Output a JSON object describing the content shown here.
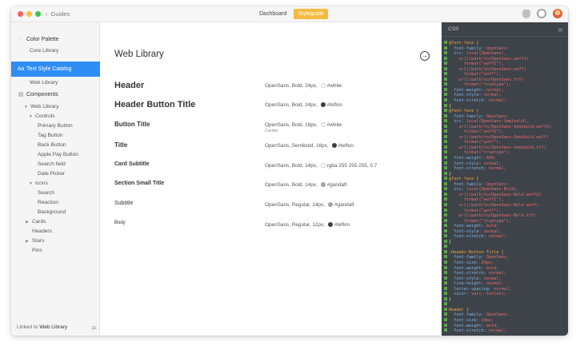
{
  "titlebar": {
    "back_label": "Guides",
    "tabs": [
      {
        "label": "Dashboard",
        "active": false
      },
      {
        "label": "Styleguide",
        "active": true
      }
    ],
    "accent": "#f7b93e"
  },
  "sidebar": {
    "items": [
      {
        "label": "Color Palette",
        "kind": "section"
      },
      {
        "label": "Core Library",
        "kind": "sub"
      },
      {
        "label": "Text Style Catalog",
        "kind": "section-selected"
      },
      {
        "label": "Web Library",
        "kind": "sub"
      },
      {
        "label": "Components",
        "kind": "section"
      },
      {
        "label": "Web Library",
        "kind": "tree1"
      },
      {
        "label": "Controls",
        "kind": "tree2"
      },
      {
        "label": "Primary Button",
        "kind": "leaf"
      },
      {
        "label": "Tag Button",
        "kind": "leaf"
      },
      {
        "label": "Back Button",
        "kind": "leaf"
      },
      {
        "label": "Apple Pay Button",
        "kind": "leaf"
      },
      {
        "label": "Search field",
        "kind": "leaf"
      },
      {
        "label": "Date Picker",
        "kind": "leaf"
      },
      {
        "label": "Icons",
        "kind": "tree2"
      },
      {
        "label": "Search",
        "kind": "leaf"
      },
      {
        "label": "Reaction",
        "kind": "leaf"
      },
      {
        "label": "Background",
        "kind": "leaf"
      },
      {
        "label": "Cards",
        "kind": "tree2c"
      },
      {
        "label": "Headers",
        "kind": "tree2n"
      },
      {
        "label": "Stars",
        "kind": "tree2c"
      },
      {
        "label": "Pins",
        "kind": "tree2n"
      }
    ],
    "footer_prefix": "Linked to",
    "footer_link": "Web Library",
    "selected_color": "#2e8ef6"
  },
  "main": {
    "title": "Web Library",
    "styles": [
      {
        "name": "Header",
        "desc": "OpenSans, Bold, 24px,",
        "color_name": "#white",
        "swatch": "#ffffff",
        "sub": ""
      },
      {
        "name": "Header Button Title",
        "desc": "OpenSans, Bold, 24px,",
        "color_name": "#teflon",
        "swatch": "#3b3f46",
        "sub": ""
      },
      {
        "name": "Button Title",
        "desc": "OpenSans, Bold, 16px,",
        "color_name": "#white",
        "swatch": "#ffffff",
        "sub": "Center"
      },
      {
        "name": "Title",
        "desc": "OpenSans, Semibold, 16px,",
        "color_name": "#teflon",
        "swatch": "#3b3f46",
        "sub": ""
      },
      {
        "name": "Card Subtitle",
        "desc": "OpenSans, Bold, 14px,",
        "color_name": "rgba 255 255 255, 0.7",
        "swatch": "#ffffff",
        "sub": ""
      },
      {
        "name": "Section Small Title",
        "desc": "OpenSans, Bold, 14px,",
        "color_name": "#gandalf",
        "swatch": "#a3a3a3",
        "sub": ""
      },
      {
        "name": "Subtitle",
        "desc": "OpenSans, Regular, 14px,",
        "color_name": "#gandalf",
        "swatch": "#a3a3a3",
        "sub": ""
      },
      {
        "name": "Body",
        "desc": "OpenSans, Regular, 12px,",
        "color_name": "#teflon",
        "swatch": "#3b3f46",
        "sub": ""
      }
    ]
  },
  "css_panel": {
    "label": "CSS",
    "lines": [
      "@font-face {",
      "  font-family: OpenSans;",
      "  src: local(OpenSans),",
      "    url(/path/to/OpenSans.woff2)",
      "      format(\"woff2\"),",
      "    url(/path/to/OpenSans.woff)",
      "      format(\"woff\"),",
      "    url(/path/to/OpenSans.ttf)",
      "      format(\"truetype\");",
      "  font-weight: normal;",
      "  font-style: normal;",
      "  font-stretch: normal;",
      "}",
      "@font-face {",
      "  font-family: OpenSans;",
      "  src: local(OpenSans-Semibold),",
      "    url(/path/to/OpenSans-Semibold.woff2)",
      "      format(\"woff2\"),",
      "    url(/path/to/OpenSans-Semibold.woff)",
      "      format(\"woff\"),",
      "    url(/path/to/OpenSans-Semibold.ttf)",
      "      format(\"truetype\");",
      "  font-weight: 600;",
      "  font-style: normal;",
      "  font-stretch: normal;",
      "}",
      "@font-face {",
      "  font-family: OpenSans;",
      "  src: local(OpenSans-Bold),",
      "    url(/path/to/OpenSans-Bold.woff2)",
      "      format(\"woff2\"),",
      "    url(/path/to/OpenSans-Bold.woff)",
      "      format(\"woff\"),",
      "    url(/path/to/OpenSans-Bold.ttf)",
      "      format(\"truetype\");",
      "  font-weight: bold;",
      "  font-style: normal;",
      "  font-stretch: normal;",
      "}",
      "",
      ".Header-Button-Title {",
      "  font-family: OpenSans;",
      "  font-size: 24px;",
      "  font-weight: bold;",
      "  font-stretch: normal;",
      "  font-style: normal;",
      "  line-height: normal;",
      "  letter-spacing: normal;",
      "  color: var(--teflon);",
      "}",
      "",
      "Header {",
      "  font-family: OpenSans;",
      "  font-size: 24px;",
      "  font-weight: bold;",
      "  font-stretch: normal;"
    ]
  }
}
